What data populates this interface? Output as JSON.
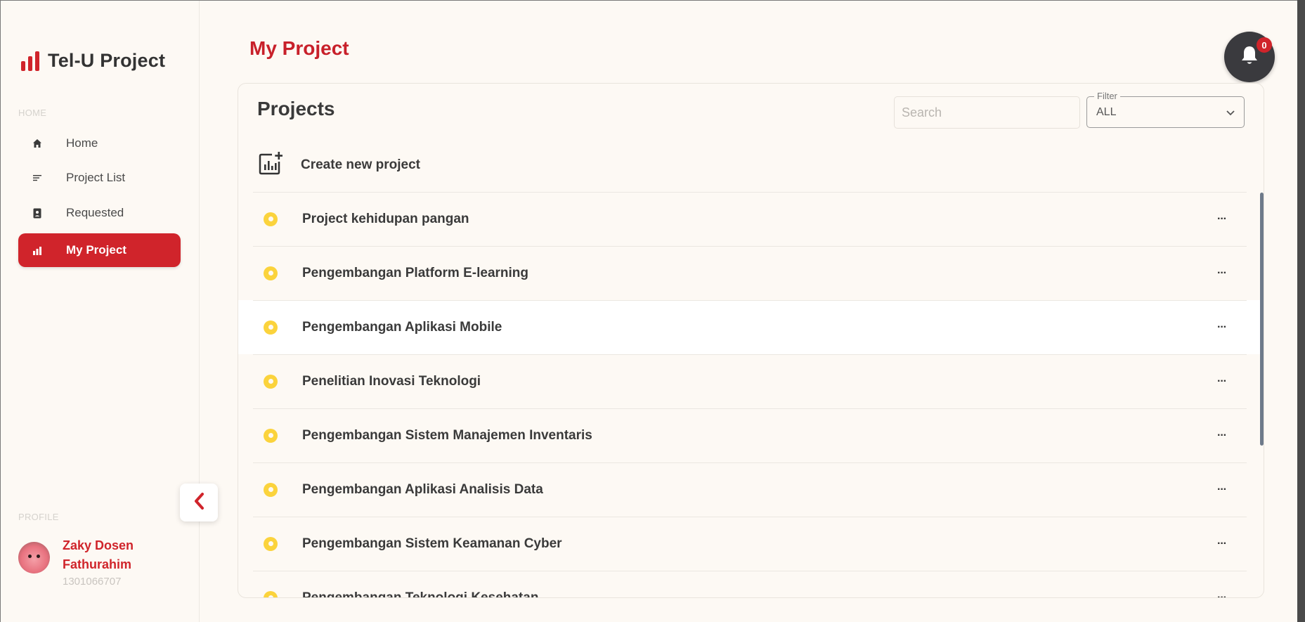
{
  "app": {
    "title": "Tel-U Project"
  },
  "sidebar": {
    "home_section_label": "HOME",
    "items": [
      {
        "label": "Home",
        "icon": "home-icon",
        "active": false
      },
      {
        "label": "Project List",
        "icon": "list-icon",
        "active": false
      },
      {
        "label": "Requested",
        "icon": "document-person-icon",
        "active": false
      },
      {
        "label": "My Project",
        "icon": "bar-chart-icon",
        "active": true
      }
    ],
    "profile_section_label": "PROFILE",
    "profile": {
      "name": "Zaky Dosen Fathurahim",
      "id": "1301066707"
    }
  },
  "header": {
    "page_title": "My Project",
    "notifications": {
      "count": "0",
      "icon": "bell-icon"
    }
  },
  "projects_card": {
    "title": "Projects",
    "search_placeholder": "Search",
    "filter": {
      "label": "Filter",
      "value": "ALL"
    },
    "create_label": "Create new project",
    "items": [
      {
        "name": "Project kehidupan pangan",
        "status_color": "#fbd33c"
      },
      {
        "name": "Pengembangan Platform E-learning",
        "status_color": "#fbd33c"
      },
      {
        "name": "Pengembangan Aplikasi Mobile",
        "status_color": "#fbd33c"
      },
      {
        "name": "Penelitian Inovasi Teknologi",
        "status_color": "#fbd33c"
      },
      {
        "name": "Pengembangan Sistem Manajemen Inventaris",
        "status_color": "#fbd33c"
      },
      {
        "name": "Pengembangan Aplikasi Analisis Data",
        "status_color": "#fbd33c"
      },
      {
        "name": "Pengembangan Sistem Keamanan Cyber",
        "status_color": "#fbd33c"
      },
      {
        "name": "Pengembangan Teknologi Kesehatan",
        "status_color": "#fbd33c"
      }
    ],
    "more_label": "···"
  },
  "colors": {
    "accent": "#d0242b",
    "background": "#fdf9f4",
    "status_pending": "#fbd33c"
  }
}
